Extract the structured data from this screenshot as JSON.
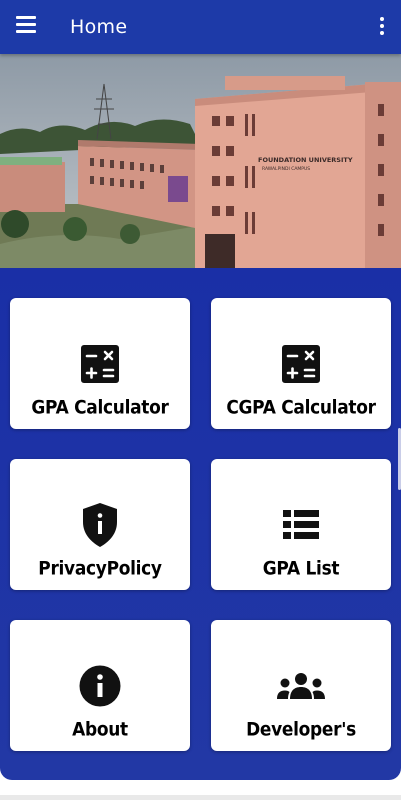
{
  "app_bar": {
    "title": "Home",
    "menu_icon": "hamburger-menu-icon",
    "more_icon": "more-vert-icon",
    "color": "#1d3aa8"
  },
  "banner": {
    "sign_line1": "FOUNDATION UNIVERSITY",
    "sign_line2": "RAWALPINDI CAMPUS"
  },
  "cards": [
    {
      "label": "GPA Calculator",
      "icon": "calculator-icon"
    },
    {
      "label": "CGPA Calculator",
      "icon": "calculator-icon"
    },
    {
      "label": "PrivacyPolicy",
      "icon": "shield-info-icon"
    },
    {
      "label": "GPA List",
      "icon": "list-icon"
    },
    {
      "label": "About",
      "icon": "info-circle-icon"
    },
    {
      "label": "Developer's",
      "icon": "group-icon"
    }
  ],
  "colors": {
    "content_background": "#1a2fa6",
    "card": "#ffffff"
  }
}
